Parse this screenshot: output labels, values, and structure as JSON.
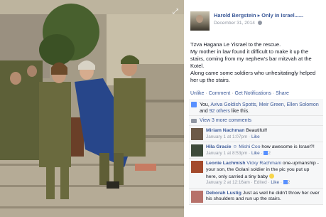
{
  "photo": {
    "description_icon": "expand-icon"
  },
  "post": {
    "author": "Harold Bergstein",
    "destination": "Only in Israel......",
    "date": "December 31, 2014",
    "text_lines": [
      "Tzva Hagana Le Yisrael to the rescue.",
      "My mother in law found it difficult to make it up the stairs, coming from my nephew's bar mitzvah at the Kotel.",
      "Along came some soldiers who unhesitatingly helped her up the stairs."
    ],
    "actions": [
      "Unlike",
      "Comment",
      "Get Notifications",
      "Share"
    ]
  },
  "likes": {
    "prefix": "You,",
    "names": "Aviva Goldish Spotts, Meir Green, Ellen Solomon",
    "and": "and",
    "others": "92 others",
    "suffix": "like this."
  },
  "view_more": "View 3 more comments",
  "comments": [
    {
      "name": "Miriam Nachman",
      "mention": "",
      "text": "Beautiful!!",
      "time": "January 1 at 1:07pm",
      "like_label": "Like",
      "likes_count": "",
      "avatar_color": "#6d5a48"
    },
    {
      "name": "Hila Gracie",
      "mention": "Mishi Coo",
      "text": "how awesome is Israel?!",
      "time": "January 1 at 8:53pm",
      "like_label": "Like",
      "likes_count": "2",
      "avatar_color": "#3d4a3a"
    },
    {
      "name": "Leonie Lachmish",
      "mention": "Vicky Rachmani",
      "text": "one-upmanship - your son, the Golani soldier in the pic you put up here, only carried a tiny baby",
      "time": "January 2 at 12:16am",
      "edited": "Edited",
      "like_label": "Like",
      "likes_count": "2",
      "avatar_color": "#a34a2c"
    },
    {
      "name": "Deborah Lustig",
      "mention": "",
      "text": "Just as well he didn't throw her over his shoulders and run up the stairs.",
      "time": "",
      "like_label": "",
      "likes_count": "",
      "avatar_color": "#b7716a"
    }
  ],
  "colors": {
    "link": "#3b5998",
    "meta": "#9197a3",
    "ufi_bg": "#f6f7f8"
  }
}
